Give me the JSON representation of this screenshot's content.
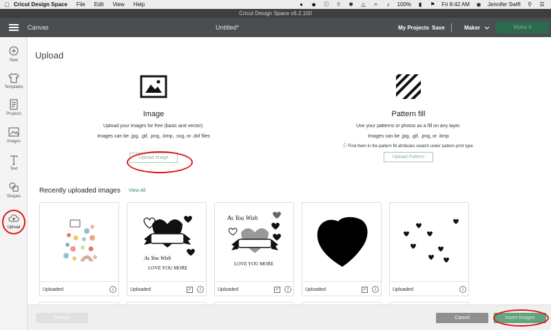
{
  "menubar": {
    "apple": "",
    "app_name": "Cricut Design Space",
    "items": [
      "File",
      "Edit",
      "View",
      "Help"
    ],
    "battery": "100%",
    "clock": "Fri 8:42 AM",
    "user": "Jennifer Swift"
  },
  "window_title": "Cricut Design Space  v6.2.100",
  "header": {
    "canvas_label": "Canvas",
    "doc_title": "Untitled*",
    "my_projects": "My Projects",
    "save": "Save",
    "machine": "Maker",
    "make_it": "Make It"
  },
  "sidebar": {
    "items": [
      {
        "label": "New",
        "icon": "plus-circle-icon"
      },
      {
        "label": "Templates",
        "icon": "tshirt-icon"
      },
      {
        "label": "Projects",
        "icon": "projects-icon"
      },
      {
        "label": "Images",
        "icon": "image-icon"
      },
      {
        "label": "Text",
        "icon": "text-icon"
      },
      {
        "label": "Shapes",
        "icon": "shapes-icon"
      },
      {
        "label": "Upload",
        "icon": "cloud-upload-icon"
      }
    ]
  },
  "page": {
    "title": "Upload",
    "image_option": {
      "heading": "Image",
      "description": "Upload your images for free (basic and vector).",
      "formats": "Images can be .jpg, .gif, .png, .bmp, .svg, or .dxf files",
      "button": "Upload Image"
    },
    "pattern_option": {
      "heading": "Pattern fill",
      "description": "Use your patterns or photos as a fill on any layer.",
      "formats": "Images can be .jpg, .gif, .png, or .bmp",
      "note": "ⓘ Find them in the pattern fill attributes swatch under pattern print type.",
      "button": "Upload Pattern"
    },
    "recent": {
      "title": "Recently uploaded images",
      "view_all": "View All"
    },
    "cards": [
      {
        "label": "Uploaded",
        "checkbox": false
      },
      {
        "label": "Uploaded",
        "checkbox": true,
        "text_top": "",
        "text_bottom_1": "AS YOU WISH",
        "text_bottom_2": "LOVE YOU MORE"
      },
      {
        "label": "Uploaded",
        "checkbox": true,
        "text_top": "AS YOU WISH",
        "text_bottom_2": "LOVE YOU MORE"
      },
      {
        "label": "Uploaded",
        "checkbox": true
      },
      {
        "label": "Uploaded",
        "checkbox": false
      }
    ]
  },
  "footer": {
    "browse": "Browse",
    "cancel": "Cancel",
    "insert": "Insert Images"
  }
}
